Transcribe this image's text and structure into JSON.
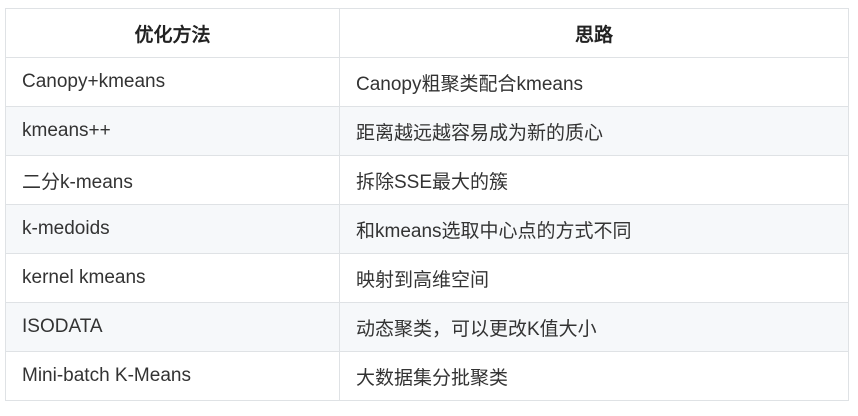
{
  "table": {
    "headers": [
      "优化方法",
      "思路"
    ],
    "rows": [
      [
        "Canopy+kmeans",
        "Canopy粗聚类配合kmeans"
      ],
      [
        "kmeans++",
        "距离越远越容易成为新的质心"
      ],
      [
        "二分k-means",
        "拆除SSE最大的簇"
      ],
      [
        "k-medoids",
        "和kmeans选取中心点的方式不同"
      ],
      [
        "kernel kmeans",
        "映射到高维空间"
      ],
      [
        "ISODATA",
        "动态聚类，可以更改K值大小"
      ],
      [
        "Mini-batch K-Means",
        "大数据集分批聚类"
      ]
    ]
  }
}
